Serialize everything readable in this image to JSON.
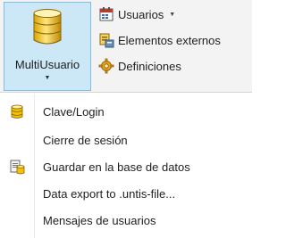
{
  "ribbon": {
    "big_button": {
      "label": "MultiUsuario",
      "icon": "database-icon"
    },
    "small_buttons": [
      {
        "label": "Usuarios",
        "icon": "users-calendar-icon",
        "has_dropdown": true
      },
      {
        "label": "Elementos externos",
        "icon": "external-elements-icon",
        "has_dropdown": false
      },
      {
        "label": "Definiciones",
        "icon": "gear-icon",
        "has_dropdown": false
      }
    ]
  },
  "menu": {
    "items": [
      {
        "label": "Clave/Login",
        "icon": "database-icon"
      },
      {
        "label": "Cierre de sesión",
        "icon": ""
      },
      {
        "label": "Guardar en la base de datos",
        "icon": "save-to-database-icon"
      },
      {
        "label": "Data export to .untis-file...",
        "icon": ""
      },
      {
        "label": "Mensajes de usuarios",
        "icon": ""
      }
    ]
  }
}
